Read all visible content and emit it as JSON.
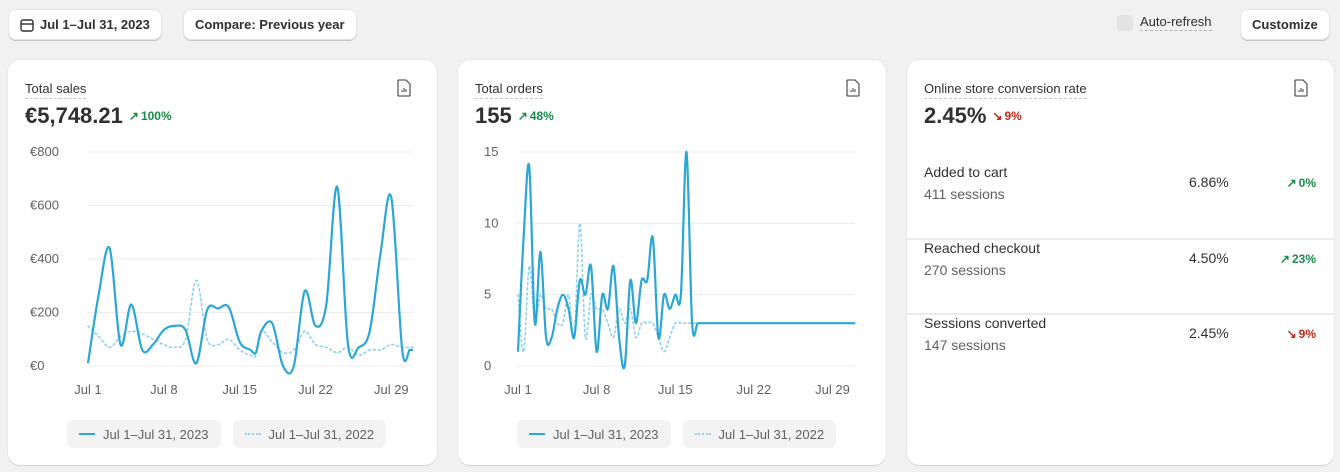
{
  "toolbar": {
    "date_range": "Jul 1–Jul 31, 2023",
    "compare": "Compare: Previous year",
    "auto_refresh": "Auto-refresh",
    "customize": "Customize"
  },
  "colors": {
    "current": "#2ba7d6",
    "previous": "#8fd0ea",
    "up": "#1a8a4a",
    "down": "#c4281c"
  },
  "cards": {
    "sales": {
      "title": "Total sales",
      "value": "€5,748.21",
      "change": "100%",
      "direction": "up",
      "icon": "report-icon"
    },
    "orders": {
      "title": "Total orders",
      "value": "155",
      "change": "48%",
      "direction": "up",
      "icon": "report-icon"
    },
    "conversion": {
      "title": "Online store conversion rate",
      "value": "2.45%",
      "change": "9%",
      "direction": "down",
      "icon": "report-icon",
      "funnel": [
        {
          "label": "Added to cart",
          "sessions": "411 sessions",
          "rate": "6.86%",
          "change": "0%",
          "direction": "up"
        },
        {
          "label": "Reached checkout",
          "sessions": "270 sessions",
          "rate": "4.50%",
          "change": "23%",
          "direction": "up"
        },
        {
          "label": "Sessions converted",
          "sessions": "147 sessions",
          "rate": "2.45%",
          "change": "9%",
          "direction": "down"
        }
      ]
    }
  },
  "legend": {
    "current": "Jul 1–Jul 31, 2023",
    "previous": "Jul 1–Jul 31, 2022"
  },
  "chart_data": [
    {
      "type": "line",
      "title": "Total sales",
      "x": [
        1,
        2,
        3,
        4,
        5,
        6,
        7,
        8,
        9,
        10,
        11,
        12,
        13,
        14,
        15,
        16,
        16.5,
        17,
        18,
        19,
        20,
        21,
        22,
        23,
        24,
        25,
        26,
        27,
        28,
        29,
        30,
        30.7,
        31
      ],
      "ylim": [
        0,
        800
      ],
      "yticks": [
        "€0",
        "€200",
        "€400",
        "€600",
        "€800"
      ],
      "ytick_values": [
        0,
        200,
        400,
        600,
        800
      ],
      "xticks": [
        "Jul 1",
        "Jul 8",
        "Jul 15",
        "Jul 22",
        "Jul 29"
      ],
      "xtick_values": [
        1,
        8,
        15,
        22,
        29
      ],
      "series": [
        {
          "name": "Jul 1–Jul 31, 2023",
          "values": [
            10,
            270,
            440,
            80,
            230,
            60,
            80,
            135,
            150,
            135,
            10,
            210,
            215,
            220,
            90,
            60,
            50,
            130,
            160,
            0,
            0,
            280,
            150,
            230,
            670,
            80,
            70,
            130,
            420,
            630,
            60,
            60,
            60
          ]
        },
        {
          "name": "Jul 1–Jul 31, 2022",
          "values": [
            150,
            110,
            70,
            110,
            130,
            120,
            100,
            80,
            70,
            100,
            320,
            100,
            80,
            100,
            60,
            40,
            40,
            130,
            90,
            50,
            60,
            130,
            80,
            70,
            50,
            70,
            40,
            60,
            60,
            80,
            70,
            70,
            70
          ]
        }
      ]
    },
    {
      "type": "line",
      "title": "Total orders",
      "x": [
        1,
        1.5,
        2,
        2.5,
        3,
        3.5,
        4,
        4.5,
        5,
        5.5,
        6,
        6.5,
        7,
        7.5,
        8,
        8.5,
        9,
        9.5,
        10,
        10.5,
        11,
        11.5,
        12,
        12.5,
        13,
        13.5,
        14,
        14.5,
        15,
        15.5,
        16,
        16.5,
        17,
        17.5,
        18,
        18.5,
        19,
        19.5,
        20,
        20.5,
        21,
        21.5,
        22,
        22.5,
        23,
        23.5,
        24,
        24.5,
        25,
        25.5,
        26,
        26.5,
        27,
        27.5,
        28,
        28.5,
        29,
        29.5,
        30,
        30.5,
        31
      ],
      "ylim": [
        0,
        15
      ],
      "yticks": [
        "0",
        "5",
        "10",
        "15"
      ],
      "ytick_values": [
        0,
        5,
        10,
        15
      ],
      "xticks": [
        "Jul 1",
        "Jul 8",
        "Jul 15",
        "Jul 22",
        "Jul 29"
      ],
      "xtick_values": [
        1,
        8,
        15,
        22,
        29
      ],
      "series": [
        {
          "name": "Jul 1–Jul 31, 2023",
          "values": [
            1,
            9,
            14,
            3,
            8,
            2,
            2,
            4,
            5,
            4,
            2,
            6,
            5,
            7,
            1,
            5,
            4,
            7,
            2,
            0,
            6,
            3,
            6,
            6,
            9,
            2,
            5,
            4,
            5,
            5,
            15,
            3,
            3,
            3,
            3,
            3,
            3,
            3,
            3,
            3,
            3,
            3,
            3,
            3,
            3,
            3,
            3,
            3,
            3,
            3,
            3,
            3,
            3,
            3,
            3,
            3,
            3,
            3,
            3,
            3,
            3
          ]
        },
        {
          "name": "Jul 1–Jul 31, 2022",
          "values": [
            5,
            1,
            7,
            3,
            5,
            4,
            4,
            3,
            3,
            5,
            2,
            10,
            2,
            5,
            4,
            4,
            3,
            2,
            4,
            3,
            4,
            2,
            3,
            3,
            3,
            2,
            1,
            2,
            3,
            3,
            3,
            3,
            3,
            3,
            3,
            3,
            3,
            3,
            3,
            3,
            3,
            3,
            3,
            3,
            3,
            3,
            3,
            3,
            3,
            3,
            3,
            3,
            3,
            3,
            3,
            3,
            3,
            3,
            3,
            3,
            3
          ]
        }
      ]
    }
  ]
}
